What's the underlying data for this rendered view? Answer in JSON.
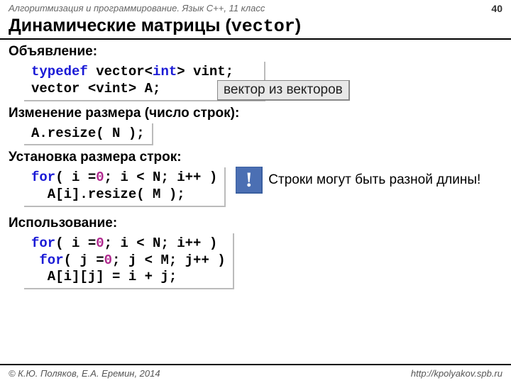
{
  "header": {
    "course": "Алгоритмизация и программирование. Язык C++, 11 класс",
    "page": "40"
  },
  "title": {
    "pre": "Динамические матрицы (",
    "mono": "vector",
    "post": ")"
  },
  "sections": {
    "decl": {
      "label": "Объявление:",
      "line1_a": "typedef",
      "line1_b": " vector<",
      "line1_c": "int",
      "line1_d": "> vint;",
      "line2": "vector <vint> A;",
      "annot": "вектор из векторов"
    },
    "resize": {
      "label": "Изменение размера (число строк):",
      "code": "A.resize( N );"
    },
    "rows": {
      "label": "Установка размера строк:",
      "line1_a": "for",
      "line1_b": "( i =",
      "line1_c": "0",
      "line1_d": "; i < N; i++ )",
      "line2": "  A[i].resize( M );",
      "warn": "Строки могут быть разной длины!"
    },
    "use": {
      "label": "Использование:",
      "l1a": "for",
      "l1b": "( i =",
      "l1c": "0",
      "l1d": "; i < N; i++ )",
      "l2a": " for",
      "l2b": "( j =",
      "l2c": "0",
      "l2d": "; j < M; j++ )",
      "l3": "  A[i][j] = i + j;"
    }
  },
  "footer": {
    "copyright": "© К.Ю. Поляков, Е.А. Еремин, 2014",
    "url": "http://kpolyakov.spb.ru"
  },
  "icons": {
    "warn": "!"
  }
}
